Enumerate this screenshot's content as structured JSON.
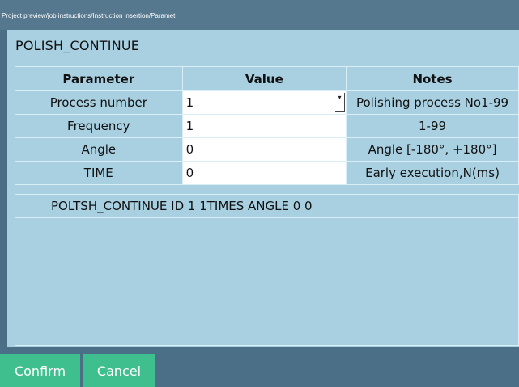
{
  "breadcrumb": "Project preview/job instructions/Instruction insertion/Paramet",
  "dialog": {
    "title": "POLISH_CONTINUE",
    "columns": {
      "parameter": "Parameter",
      "value": "Value",
      "notes": "Notes"
    },
    "rows": [
      {
        "parameter": "Process number",
        "value": "1",
        "notes": "Polishing process No1-99",
        "dropdown": true
      },
      {
        "parameter": "Frequency",
        "value": "1",
        "notes": "1-99"
      },
      {
        "parameter": "Angle",
        "value": "0",
        "notes": "Angle [-180°, +180°]"
      },
      {
        "parameter": "TIME",
        "value": "0",
        "notes": "Early execution,N(ms)"
      }
    ],
    "summary": "POLTSH_CONTINUE ID 1 1TIMES ANGLE 0 0"
  },
  "buttons": {
    "confirm": "Confirm",
    "cancel": "Cancel"
  },
  "icons": {
    "dropdown": "chevron-down-icon"
  },
  "colors": {
    "panel": "#a8d0e1",
    "header_bar": "#56788e",
    "button": "#3fbf8d",
    "background": "#4a6f86"
  }
}
